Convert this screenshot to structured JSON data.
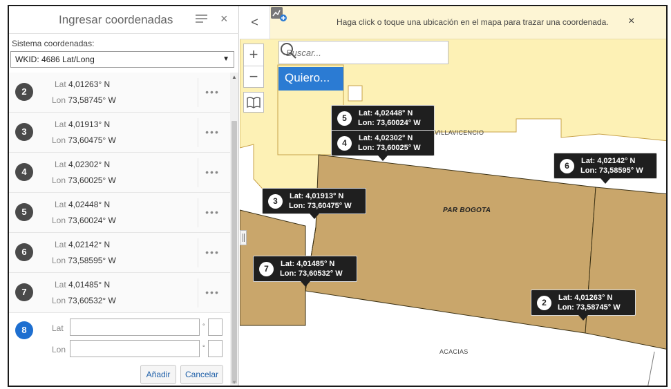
{
  "panel": {
    "title": "Ingresar coordenadas",
    "close_label": "×",
    "system_label": "Sistema coordenadas:",
    "system_value": "WKID: 4686 Lat/Long",
    "lat_prefix": "Lat",
    "lon_prefix": "Lon",
    "more_label": "•••",
    "rows": [
      {
        "num": "2",
        "lat": "4,01263° N",
        "lon": "73,58745° W"
      },
      {
        "num": "3",
        "lat": "4,01913° N",
        "lon": "73,60475° W"
      },
      {
        "num": "4",
        "lat": "4,02302° N",
        "lon": "73,60025° W"
      },
      {
        "num": "5",
        "lat": "4,02448° N",
        "lon": "73,60024° W"
      },
      {
        "num": "6",
        "lat": "4,02142° N",
        "lon": "73,58595° W"
      },
      {
        "num": "7",
        "lat": "4,01485° N",
        "lon": "73,60532° W"
      }
    ],
    "new_entry": {
      "num": "8",
      "lat_label": "Lat",
      "lon_label": "Lon",
      "lat_value": "",
      "lon_value": "",
      "degree_symbol": "°",
      "add_label": "Añadir",
      "cancel_label": "Cancelar"
    }
  },
  "map": {
    "back_label": "<",
    "notice_text": "Haga click o toque una ubicación en el mapa para trazar una coordenada.",
    "notice_close": "×",
    "zoom_in": "+",
    "zoom_out": "−",
    "search_placeholder": "Buscar...",
    "quiero_label": "Quiero...",
    "labels": {
      "villavicencio": "VILLAVICENCIO",
      "par_bogota": "PAR BOGOTA",
      "acacias": "ACACIAS"
    },
    "pins": [
      {
        "num": "5",
        "lat": "Lat: 4,02448° N",
        "lon": "Lon: 73,60024° W"
      },
      {
        "num": "4",
        "lat": "Lat: 4,02302° N",
        "lon": "Lon: 73,60025° W"
      },
      {
        "num": "6",
        "lat": "Lat: 4,02142° N",
        "lon": "Lon: 73,58595° W"
      },
      {
        "num": "3",
        "lat": "Lat: 4,01913° N",
        "lon": "Lon: 73,60475° W"
      },
      {
        "num": "7",
        "lat": "Lat: 4,01485° N",
        "lon": "Lon: 73,60532° W"
      },
      {
        "num": "2",
        "lat": "Lat: 4,01263° N",
        "lon": "Lon: 73,58745° W"
      }
    ]
  },
  "colors": {
    "parcel": "#c9a66b",
    "urban": "#fdf1b5",
    "accent": "#2b7bd3",
    "active_point": "#1e6fd0"
  }
}
